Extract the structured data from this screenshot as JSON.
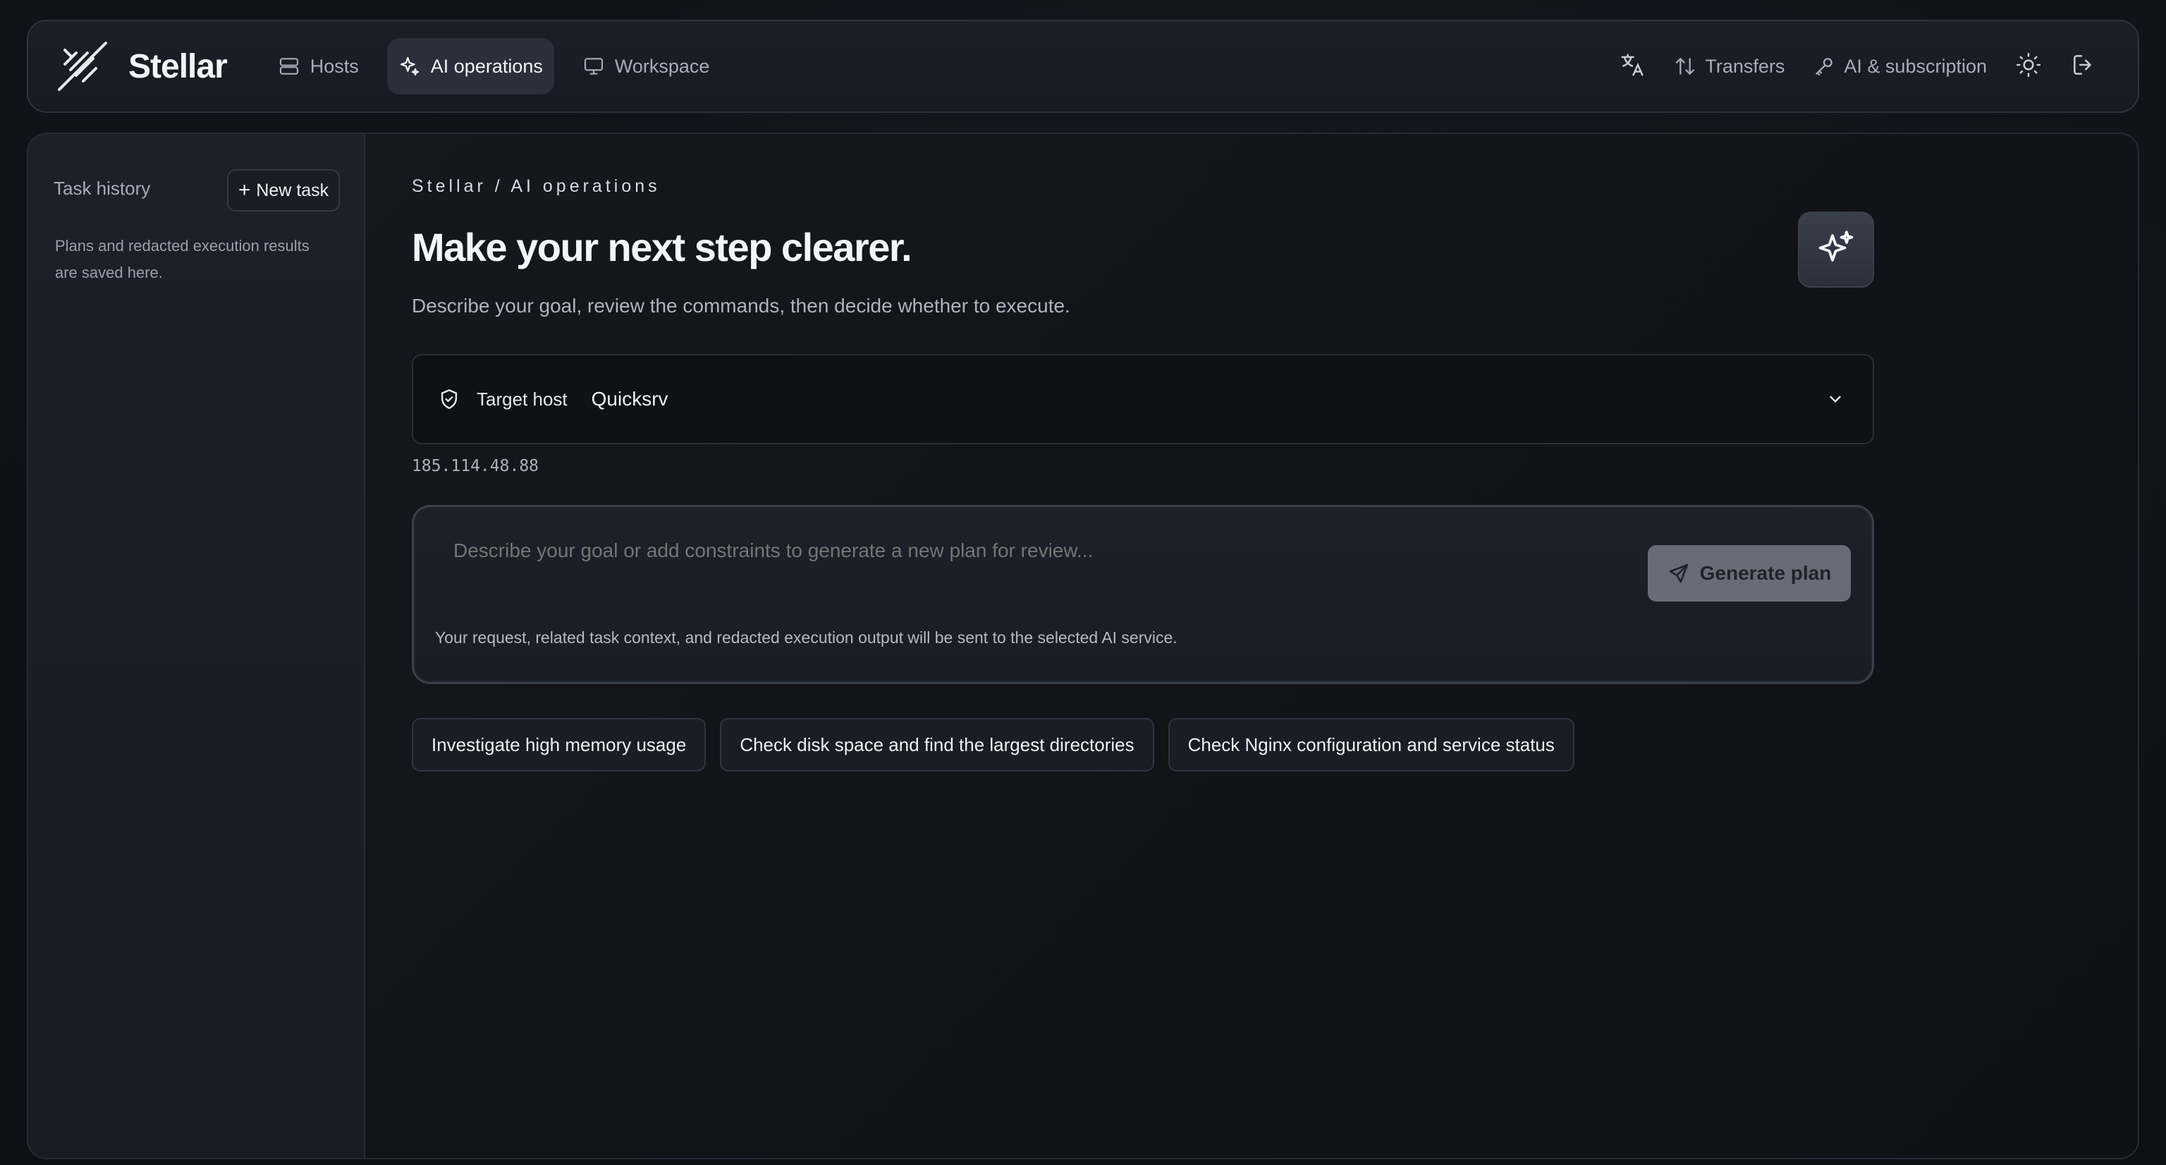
{
  "app": {
    "name": "Stellar"
  },
  "nav": {
    "items": [
      {
        "label": "Hosts",
        "icon": "server-icon",
        "active": false
      },
      {
        "label": "AI operations",
        "icon": "sparkles-icon",
        "active": true
      },
      {
        "label": "Workspace",
        "icon": "monitor-icon",
        "active": false
      }
    ],
    "right": {
      "translate_icon": "translate-icon",
      "transfers_label": "Transfers",
      "ai_subscription_label": "AI & subscription",
      "theme_icon": "sun-icon",
      "logout_icon": "logout-icon"
    }
  },
  "sidebar": {
    "title": "Task history",
    "new_task_label": "New task",
    "empty_text": "Plans and redacted execution results are saved here."
  },
  "main": {
    "breadcrumb": "Stellar / AI operations",
    "title": "Make your next step clearer.",
    "subtitle": "Describe your goal, review the commands, then decide whether to execute.",
    "target_host_label": "Target host",
    "target_host_value": "Quicksrv",
    "host_ip": "185.114.48.88",
    "composer": {
      "placeholder": "Describe your goal or add constraints to generate a new plan for review...",
      "generate_label": "Generate plan",
      "note": "Your request, related task context, and redacted execution output will be sent to the selected AI service."
    },
    "suggestions": [
      "Investigate high memory usage",
      "Check disk space and find the largest directories",
      "Check Nginx configuration and service status"
    ]
  },
  "colors": {
    "background": "#0f1117",
    "panel": "#171a22",
    "accent_button": "#676c77",
    "text_primary": "#f4f5f8",
    "text_muted": "#a8adba"
  }
}
